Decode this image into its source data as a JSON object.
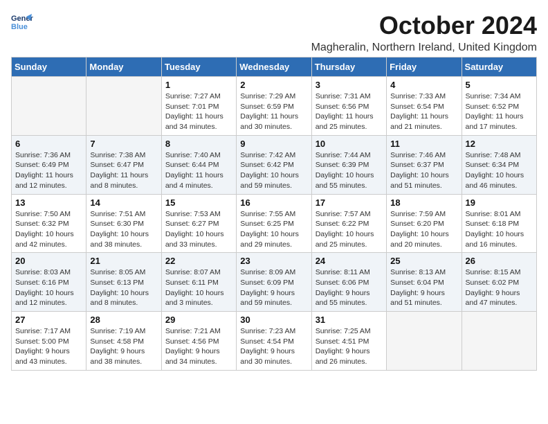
{
  "logo": {
    "line1": "General",
    "line2": "Blue"
  },
  "title": "October 2024",
  "location": "Magheralin, Northern Ireland, United Kingdom",
  "days_of_week": [
    "Sunday",
    "Monday",
    "Tuesday",
    "Wednesday",
    "Thursday",
    "Friday",
    "Saturday"
  ],
  "weeks": [
    [
      {
        "day": "",
        "info": "",
        "empty": true
      },
      {
        "day": "",
        "info": "",
        "empty": true
      },
      {
        "day": "1",
        "info": "Sunrise: 7:27 AM\nSunset: 7:01 PM\nDaylight: 11 hours\nand 34 minutes."
      },
      {
        "day": "2",
        "info": "Sunrise: 7:29 AM\nSunset: 6:59 PM\nDaylight: 11 hours\nand 30 minutes."
      },
      {
        "day": "3",
        "info": "Sunrise: 7:31 AM\nSunset: 6:56 PM\nDaylight: 11 hours\nand 25 minutes."
      },
      {
        "day": "4",
        "info": "Sunrise: 7:33 AM\nSunset: 6:54 PM\nDaylight: 11 hours\nand 21 minutes."
      },
      {
        "day": "5",
        "info": "Sunrise: 7:34 AM\nSunset: 6:52 PM\nDaylight: 11 hours\nand 17 minutes."
      }
    ],
    [
      {
        "day": "6",
        "info": "Sunrise: 7:36 AM\nSunset: 6:49 PM\nDaylight: 11 hours\nand 12 minutes.",
        "shaded": true
      },
      {
        "day": "7",
        "info": "Sunrise: 7:38 AM\nSunset: 6:47 PM\nDaylight: 11 hours\nand 8 minutes.",
        "shaded": true
      },
      {
        "day": "8",
        "info": "Sunrise: 7:40 AM\nSunset: 6:44 PM\nDaylight: 11 hours\nand 4 minutes.",
        "shaded": true
      },
      {
        "day": "9",
        "info": "Sunrise: 7:42 AM\nSunset: 6:42 PM\nDaylight: 10 hours\nand 59 minutes.",
        "shaded": true
      },
      {
        "day": "10",
        "info": "Sunrise: 7:44 AM\nSunset: 6:39 PM\nDaylight: 10 hours\nand 55 minutes.",
        "shaded": true
      },
      {
        "day": "11",
        "info": "Sunrise: 7:46 AM\nSunset: 6:37 PM\nDaylight: 10 hours\nand 51 minutes.",
        "shaded": true
      },
      {
        "day": "12",
        "info": "Sunrise: 7:48 AM\nSunset: 6:34 PM\nDaylight: 10 hours\nand 46 minutes.",
        "shaded": true
      }
    ],
    [
      {
        "day": "13",
        "info": "Sunrise: 7:50 AM\nSunset: 6:32 PM\nDaylight: 10 hours\nand 42 minutes."
      },
      {
        "day": "14",
        "info": "Sunrise: 7:51 AM\nSunset: 6:30 PM\nDaylight: 10 hours\nand 38 minutes."
      },
      {
        "day": "15",
        "info": "Sunrise: 7:53 AM\nSunset: 6:27 PM\nDaylight: 10 hours\nand 33 minutes."
      },
      {
        "day": "16",
        "info": "Sunrise: 7:55 AM\nSunset: 6:25 PM\nDaylight: 10 hours\nand 29 minutes."
      },
      {
        "day": "17",
        "info": "Sunrise: 7:57 AM\nSunset: 6:22 PM\nDaylight: 10 hours\nand 25 minutes."
      },
      {
        "day": "18",
        "info": "Sunrise: 7:59 AM\nSunset: 6:20 PM\nDaylight: 10 hours\nand 20 minutes."
      },
      {
        "day": "19",
        "info": "Sunrise: 8:01 AM\nSunset: 6:18 PM\nDaylight: 10 hours\nand 16 minutes."
      }
    ],
    [
      {
        "day": "20",
        "info": "Sunrise: 8:03 AM\nSunset: 6:16 PM\nDaylight: 10 hours\nand 12 minutes.",
        "shaded": true
      },
      {
        "day": "21",
        "info": "Sunrise: 8:05 AM\nSunset: 6:13 PM\nDaylight: 10 hours\nand 8 minutes.",
        "shaded": true
      },
      {
        "day": "22",
        "info": "Sunrise: 8:07 AM\nSunset: 6:11 PM\nDaylight: 10 hours\nand 3 minutes.",
        "shaded": true
      },
      {
        "day": "23",
        "info": "Sunrise: 8:09 AM\nSunset: 6:09 PM\nDaylight: 9 hours\nand 59 minutes.",
        "shaded": true
      },
      {
        "day": "24",
        "info": "Sunrise: 8:11 AM\nSunset: 6:06 PM\nDaylight: 9 hours\nand 55 minutes.",
        "shaded": true
      },
      {
        "day": "25",
        "info": "Sunrise: 8:13 AM\nSunset: 6:04 PM\nDaylight: 9 hours\nand 51 minutes.",
        "shaded": true
      },
      {
        "day": "26",
        "info": "Sunrise: 8:15 AM\nSunset: 6:02 PM\nDaylight: 9 hours\nand 47 minutes.",
        "shaded": true
      }
    ],
    [
      {
        "day": "27",
        "info": "Sunrise: 7:17 AM\nSunset: 5:00 PM\nDaylight: 9 hours\nand 43 minutes."
      },
      {
        "day": "28",
        "info": "Sunrise: 7:19 AM\nSunset: 4:58 PM\nDaylight: 9 hours\nand 38 minutes."
      },
      {
        "day": "29",
        "info": "Sunrise: 7:21 AM\nSunset: 4:56 PM\nDaylight: 9 hours\nand 34 minutes."
      },
      {
        "day": "30",
        "info": "Sunrise: 7:23 AM\nSunset: 4:54 PM\nDaylight: 9 hours\nand 30 minutes."
      },
      {
        "day": "31",
        "info": "Sunrise: 7:25 AM\nSunset: 4:51 PM\nDaylight: 9 hours\nand 26 minutes."
      },
      {
        "day": "",
        "info": "",
        "empty": true
      },
      {
        "day": "",
        "info": "",
        "empty": true
      }
    ]
  ]
}
